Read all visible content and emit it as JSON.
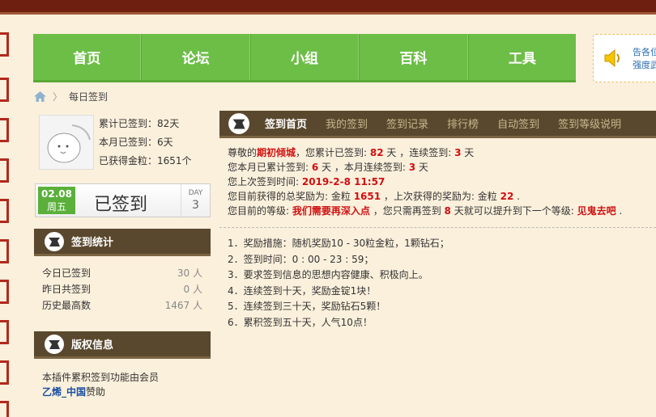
{
  "nav": {
    "items": [
      "首页",
      "论坛",
      "小组",
      "百科",
      "工具"
    ]
  },
  "notice": {
    "line1": "告各位",
    "line2": "强度武"
  },
  "breadcrumb": {
    "current": "每日签到"
  },
  "user": {
    "total_label": "累计已签到：",
    "total_value": "82天",
    "month_label": "本月已签到：",
    "month_value": "6天",
    "coins_label": "已获得金粒：",
    "coins_value": "1651个"
  },
  "signbox": {
    "date": "02.08",
    "weekday": "周五",
    "status": "已签到",
    "day_label": "DAY",
    "day_value": "3"
  },
  "stats": {
    "title": "签到统计",
    "rows": [
      {
        "label": "今日已签到",
        "value": "30 人"
      },
      {
        "label": "昨日共签到",
        "value": "0 人"
      },
      {
        "label": "历史最高数",
        "value": "1467 人"
      }
    ]
  },
  "copyright": {
    "title": "版权信息",
    "line1": "本插件累积签到功能由会员",
    "member": "乙烯_中国",
    "suffix": "赞助"
  },
  "tabs": [
    "签到首页",
    "我的签到",
    "签到记录",
    "排行榜",
    "自动签到",
    "签到等级说明"
  ],
  "info": {
    "l1_a": "尊敬的",
    "username": "期初倾城",
    "l1_b": "，您累计已签到: ",
    "total": "82",
    "l1_c": " 天 ，连续签到: ",
    "streak": "3",
    "l1_d": " 天",
    "l2_a": "您本月已累计签到: ",
    "month": "6",
    "l2_b": " 天 ，本月连续签到: ",
    "month_streak": "3",
    "l2_c": " 天",
    "l3_a": "您上次签到时间: ",
    "last_time": "2019-2-8 11:57",
    "l4_a": "您目前获得的总奖励为: 金粒 ",
    "total_reward": "1651",
    "l4_b": " ，上次获得的奖励为: 金粒 ",
    "last_reward": "22",
    "l4_c": " .",
    "l5_a": "您目前的等级: ",
    "level": "我们需要再深入点",
    "l5_b": " ，您只需再签到 ",
    "need_days": "8",
    "l5_c": " 天就可以提升到下一个等级: ",
    "next_level": "见鬼去吧",
    "l5_d": " ."
  },
  "rules": [
    "1．奖励措施：随机奖励10 - 30粒金粒，1颗钻石；",
    "2．签到时间：0 : 00 - 23 : 59；",
    "3．要求签到信息的思想内容健康、积极向上。",
    "4．连续签到十天，奖励金锭1块！",
    "5．连续签到三十天，奖励钻石5颗！",
    "6．累积签到五十天，人气10点！"
  ]
}
